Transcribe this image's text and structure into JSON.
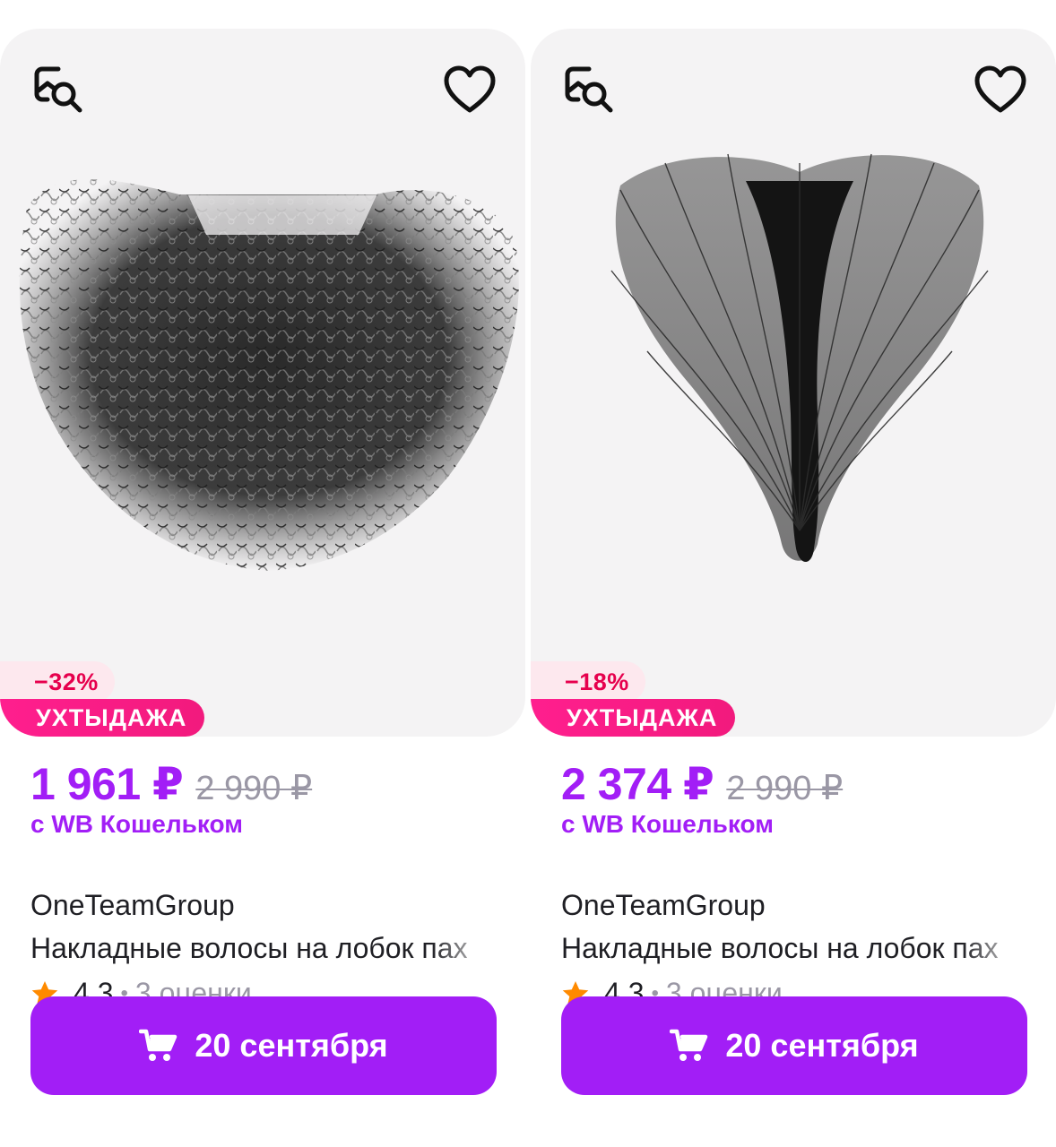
{
  "products": [
    {
      "discount": "−32%",
      "promo": "УХТЫДАЖА",
      "price": "1 961 ₽",
      "old_price": "2 990 ₽",
      "wallet_note": "с WB Кошельком",
      "brand": "OneTeamGroup",
      "title": "Накладные волосы на лобок пах",
      "rating": "4,3",
      "reviews": "3 оценки",
      "delivery": "20 сентября"
    },
    {
      "discount": "−18%",
      "promo": "УХТЫДАЖА",
      "price": "2 374 ₽",
      "old_price": "2 990 ₽",
      "wallet_note": "с WB Кошельком",
      "brand": "OneTeamGroup",
      "title": "Накладные волосы на лобок пах",
      "rating": "4,3",
      "reviews": "3 оценки",
      "delivery": "20 сентября"
    }
  ],
  "icons": {
    "search": "image-search-icon",
    "favorite": "heart-icon",
    "rating": "star-icon",
    "cart": "cart-icon"
  },
  "colors": {
    "accent": "#a21ef6",
    "promo": "#ff1f8e",
    "discount": "#e6004d",
    "star": "#ff8a00"
  }
}
